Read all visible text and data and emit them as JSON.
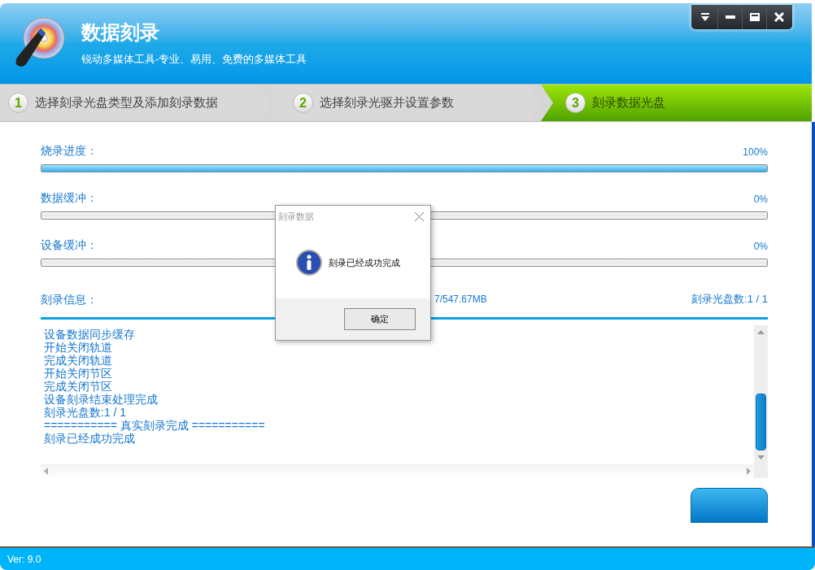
{
  "window": {
    "title": "数据刻录",
    "subtitle": "锐动多媒体工具-专业、易用、免费的多媒体工具"
  },
  "steps": [
    {
      "number": "1",
      "label": "选择刻录光盘类型及添加刻录数据",
      "selected": false
    },
    {
      "number": "2",
      "label": "选择刻录光驱并设置参数",
      "selected": false
    },
    {
      "number": "3",
      "label": "刻录数据光盘",
      "selected": true
    }
  ],
  "meters": [
    {
      "label": "烧录进度：",
      "reading": "100%",
      "level": 1
    },
    {
      "label": "数据缓冲：",
      "reading": "0%",
      "level": 0
    },
    {
      "label": "设备缓冲：",
      "reading": "0%",
      "level": 0
    }
  ],
  "info": {
    "label": "刻录信息：",
    "size": "7/547.67MB",
    "discs": "刻录光盘数:1 / 1"
  },
  "log": [
    "设备数据同步缓存",
    "开始关闭轨道",
    "完成关闭轨道",
    "开始关闭节区",
    "完成关闭节区",
    "设备刻录结束处理完成",
    "刻录光盘数:1 / 1",
    "=========== 真实刻录完成 ===========",
    "刻录已经成功完成"
  ],
  "dialog": {
    "title": "刻录数据",
    "message": "刻录已经成功完成",
    "button": "确定"
  },
  "status_bar": "Ver: 9.0"
}
